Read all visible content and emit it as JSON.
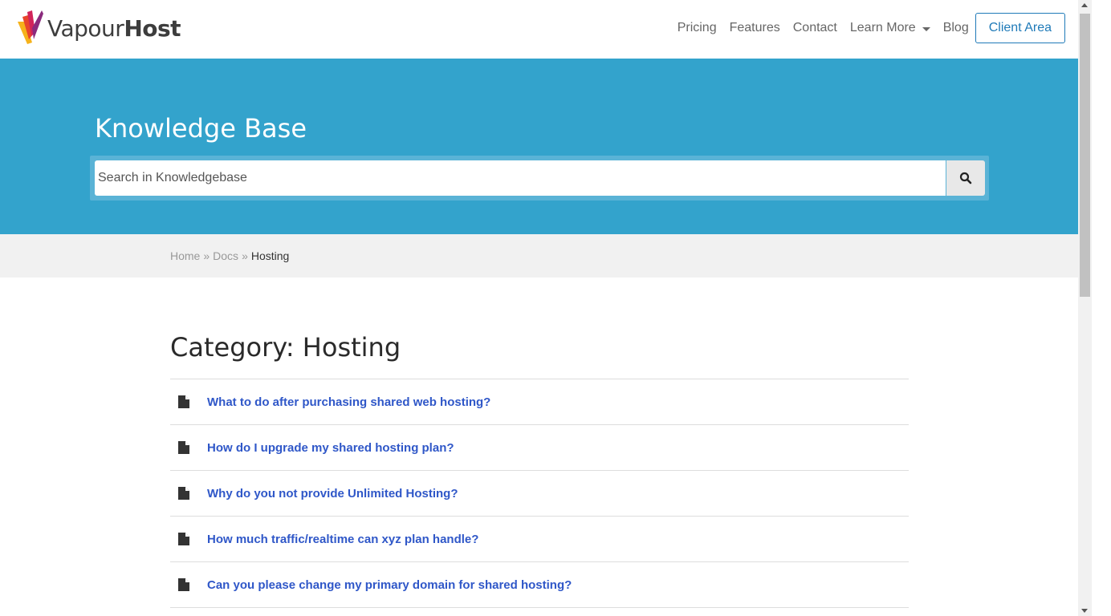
{
  "logo": {
    "name_light": "Vapour",
    "name_bold": "Host"
  },
  "nav": {
    "items": [
      {
        "label": "Pricing"
      },
      {
        "label": "Features"
      },
      {
        "label": "Contact"
      },
      {
        "label": "Learn More"
      },
      {
        "label": "Blog"
      }
    ],
    "client_area_label": "Client Area"
  },
  "hero": {
    "title": "Knowledge Base",
    "search_placeholder": "Search in Knowledgebase"
  },
  "breadcrumb": {
    "items": [
      "Home",
      "Docs"
    ],
    "separator": "»",
    "current": "Hosting"
  },
  "category": {
    "title": "Category: Hosting",
    "articles": [
      "What to do after purchasing shared web hosting?",
      "How do I upgrade my shared hosting plan?",
      "Why do you not provide Unlimited Hosting?",
      "How much traffic/realtime can xyz plan handle?",
      "Can you please change my primary domain for shared hosting?"
    ]
  },
  "colors": {
    "hero_bg": "#33a3cc",
    "link": "#2f57c8",
    "client_button": "#1f7ab8"
  }
}
